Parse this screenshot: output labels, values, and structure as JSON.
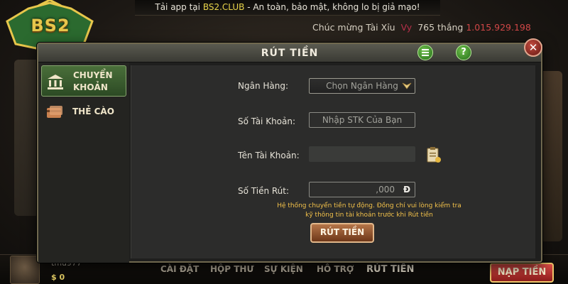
{
  "banner": {
    "prefix": "Tải app tại ",
    "site": "BS2.CLUB",
    "suffix": " - An toàn, bảo mật, không lo bị giả mạo!"
  },
  "marquee": {
    "prefix": "Chúc mừng Tài Xỉu",
    "winner": "Vy",
    "id": "765",
    "verb": "thắng",
    "amount": "1.015.929.198"
  },
  "logo": {
    "text": "BS2"
  },
  "modal": {
    "title": "RÚT TIỀN",
    "close_label": "✕",
    "help_label": "?"
  },
  "tabs": [
    {
      "line1": "CHUYỂN",
      "line2": "KHOẢN",
      "active": true
    },
    {
      "line1": "THẺ CÀO",
      "line2": "",
      "active": false
    }
  ],
  "form": {
    "bank_label": "Ngân Hàng:",
    "bank_value": "Chọn Ngân Hàng",
    "account_no_label": "Số Tài Khoản:",
    "account_no_placeholder": "Nhập STK Của Bạn",
    "account_name_label": "Tên Tài Khoản:",
    "account_name_value": "",
    "amount_label": "Số Tiền Rút:",
    "amount_value": ",000",
    "currency": "Đ",
    "notice_line1": "Hệ thống chuyển tiền tự động. Đồng chí vui lòng kiểm tra",
    "notice_line2": "kỹ thông tin tài khoản trước khi Rút tiền",
    "submit_label": "RÚT TIỀN"
  },
  "bottom_nav": [
    "CÀI ĐẶT",
    "HỘP THƯ",
    "SỰ KIỆN",
    "HỖ TRỢ",
    "RÚT TIỀN"
  ],
  "user": {
    "name": "tmu977",
    "balance_prefix": "$",
    "balance": "0"
  },
  "nap_tien_label": "NẠP TIỀN",
  "colors": {
    "accent_green": "#4a6f3a",
    "notice_yellow": "#f2c14a",
    "button_brown": "#8a4a24",
    "close_red": "#c24c3f"
  }
}
